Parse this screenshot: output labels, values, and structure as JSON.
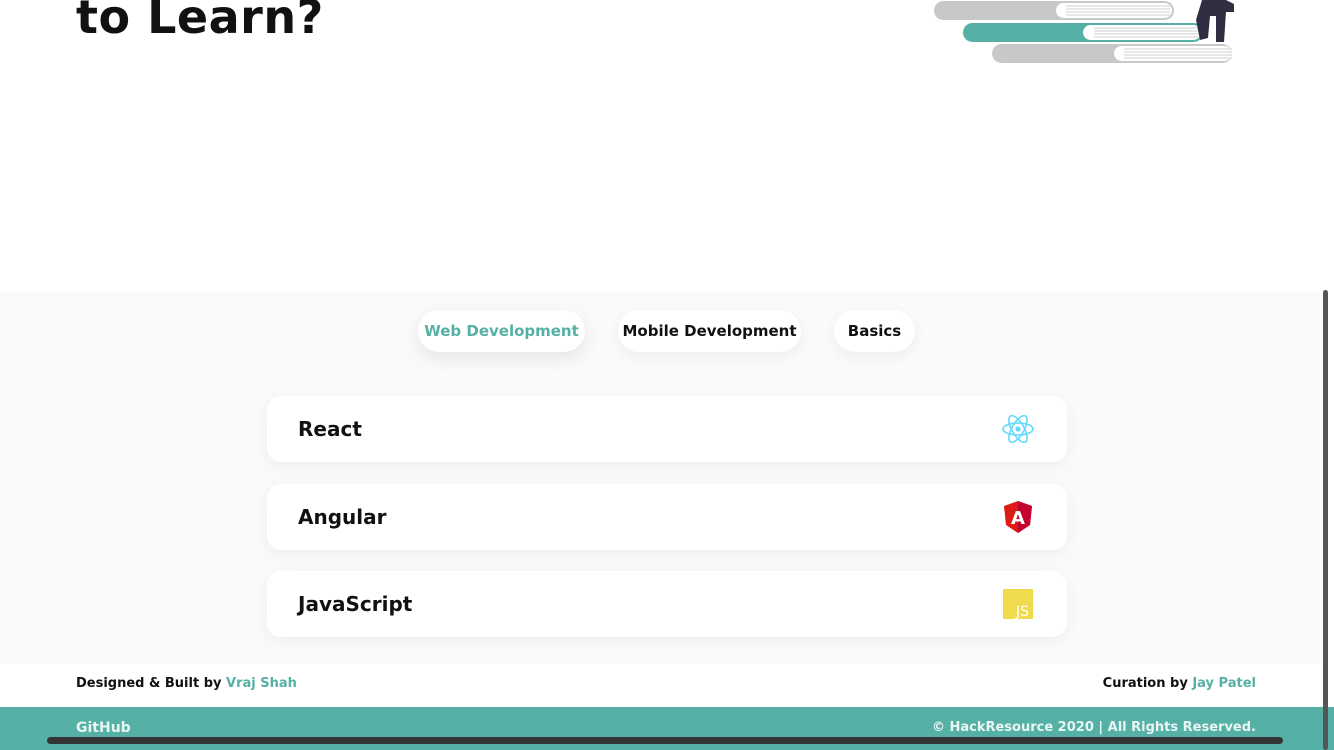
{
  "hero": {
    "title": "to Learn?"
  },
  "tabs": [
    {
      "label": "Web Development",
      "active": true
    },
    {
      "label": "Mobile Development",
      "active": false
    },
    {
      "label": "Basics",
      "active": false
    }
  ],
  "cards": [
    {
      "title": "React",
      "icon": "react-icon"
    },
    {
      "title": "Angular",
      "icon": "angular-icon"
    },
    {
      "title": "JavaScript",
      "icon": "javascript-icon"
    }
  ],
  "icon_text": {
    "angular": "A",
    "javascript": "JS"
  },
  "credits": {
    "left_prefix": "Designed & Built by",
    "left_name": "Vraj Shah",
    "right_prefix": "Curation by",
    "right_name": "Jay Patel"
  },
  "footer": {
    "github_label": "GitHub",
    "copyright": "© HackResource 2020 | All Rights Reserved."
  },
  "colors": {
    "accent": "#55b0a5",
    "react": "#61dafb",
    "angular": "#dd1b16",
    "javascript": "#f0db4f"
  }
}
